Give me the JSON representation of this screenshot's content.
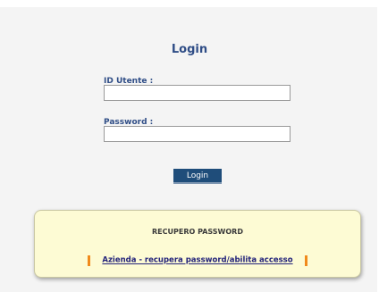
{
  "login": {
    "title": "Login",
    "user_id_label": "ID Utente :",
    "user_id_value": "",
    "password_label": "Password :",
    "password_value": "",
    "submit_label": "Login"
  },
  "recovery": {
    "title": "RECUPERO PASSWORD",
    "link_label": "Azienda - recupera password/abilita accesso"
  },
  "colors": {
    "background": "#f4f4f4",
    "label_text": "#2f4d86",
    "button_bg": "#1f4d7a",
    "recovery_bg": "#fdfbd4",
    "marker": "#f08a1c",
    "link": "#23237a"
  }
}
